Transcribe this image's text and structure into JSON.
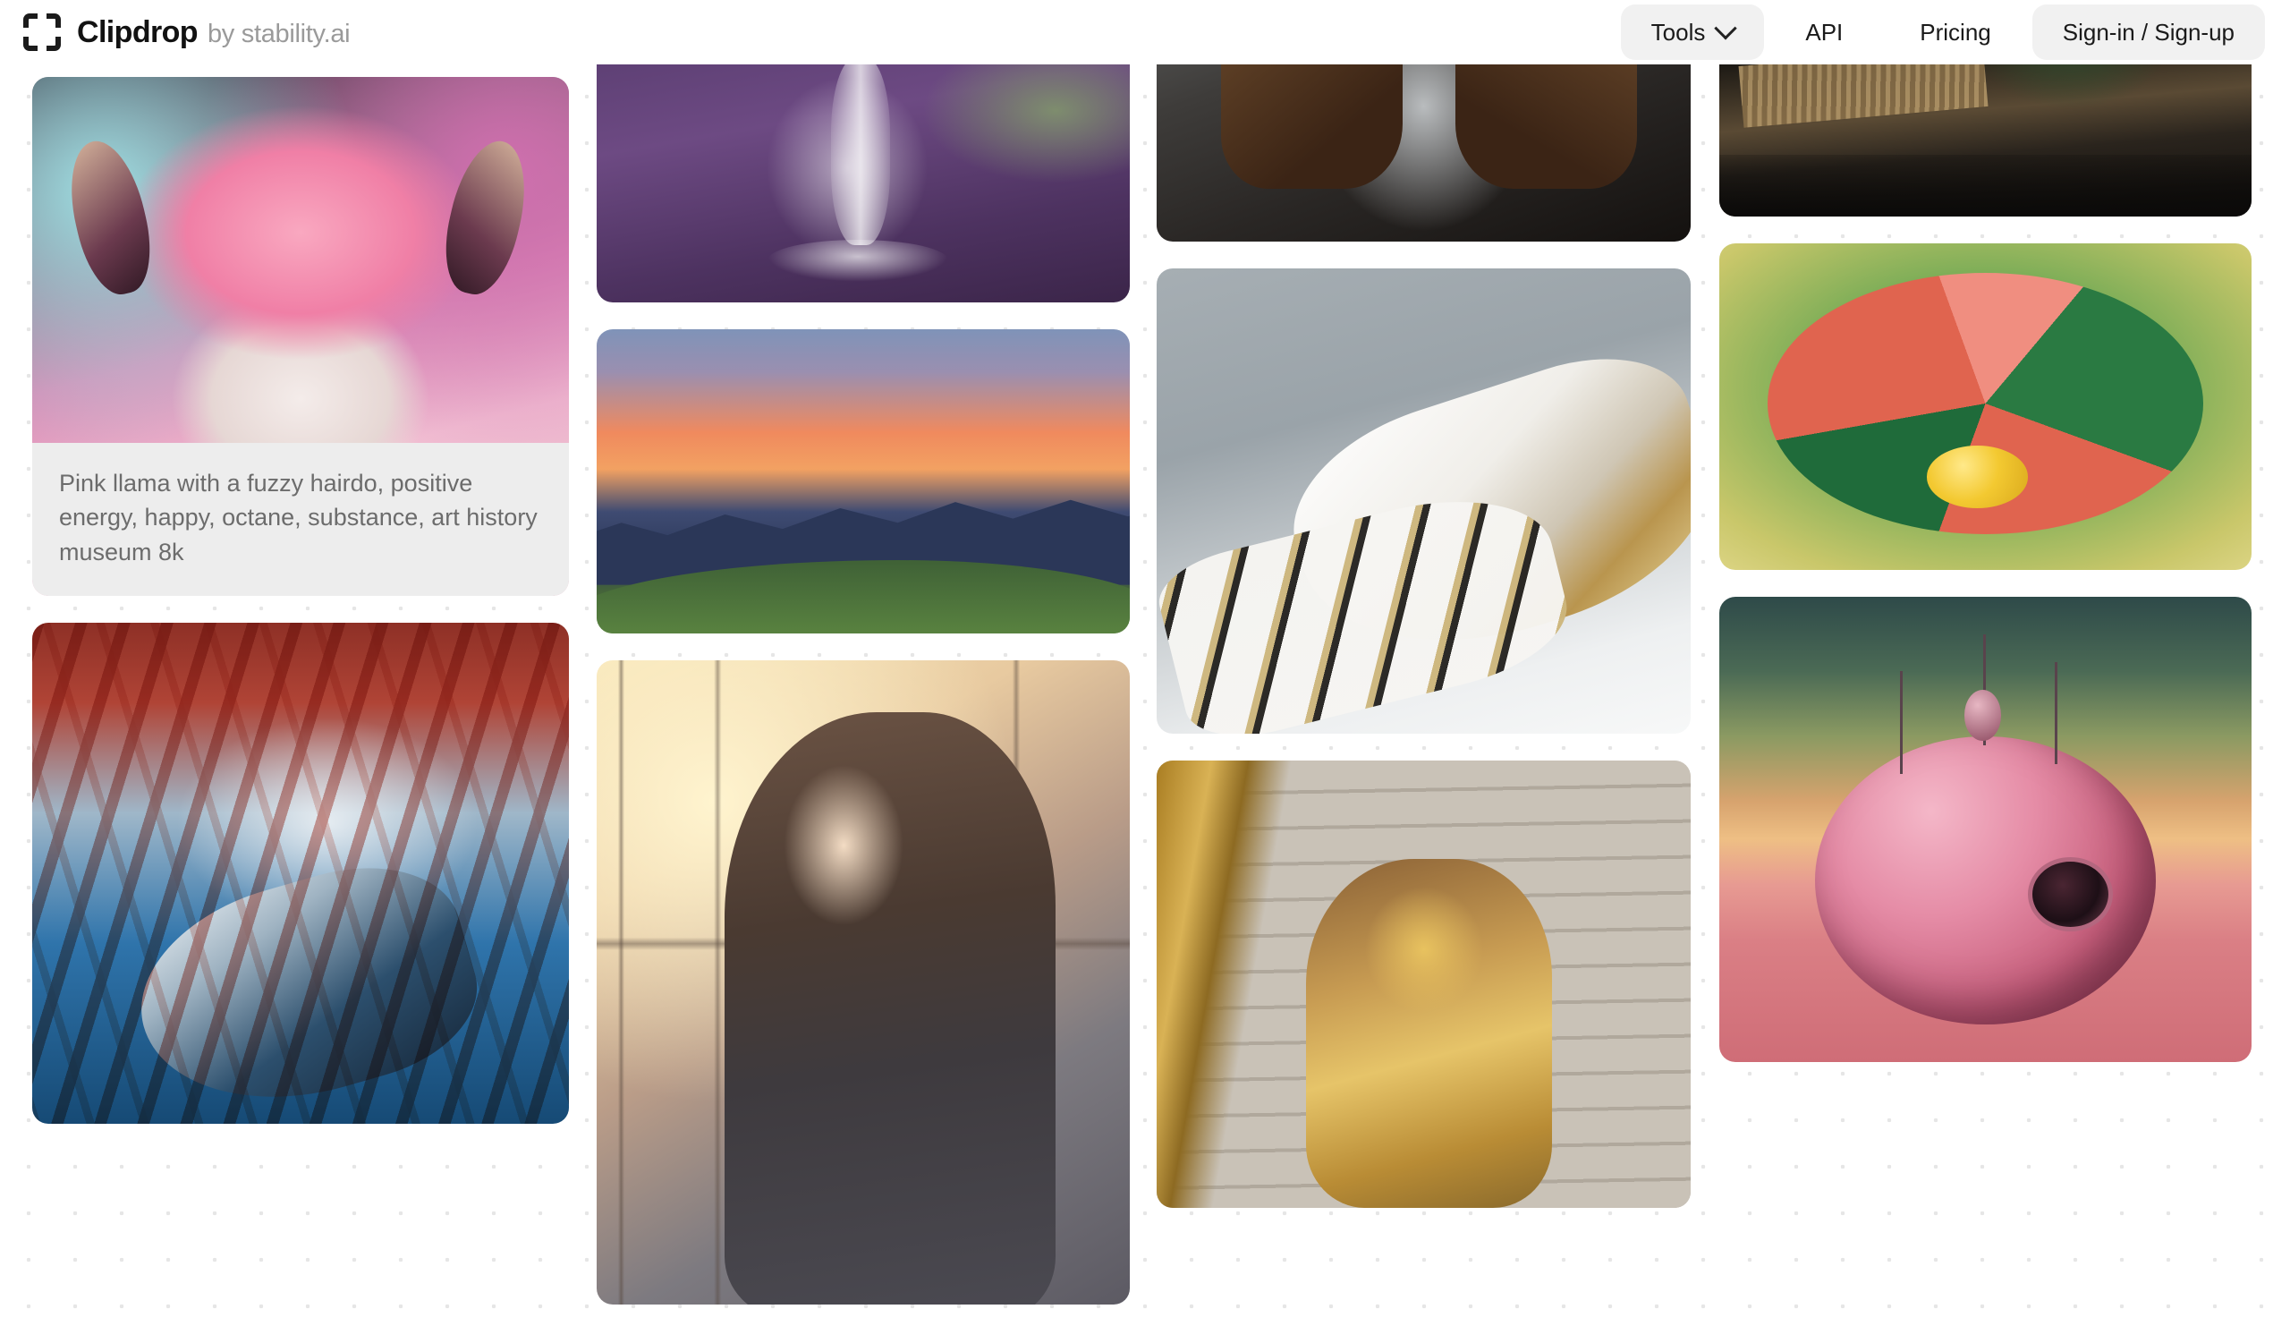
{
  "header": {
    "logo": {
      "icon": "clipdrop-brackets-icon",
      "name": "Clipdrop",
      "by": "by stability.ai"
    },
    "nav": {
      "tools": {
        "label": "Tools",
        "chevron_icon": "chevron-down-icon"
      },
      "api": {
        "label": "API"
      },
      "pricing": {
        "label": "Pricing"
      },
      "signin": {
        "label": "Sign-in / Sign-up"
      }
    }
  },
  "gallery": {
    "columns": [
      {
        "cards": [
          {
            "name": "pink-llama",
            "alt": "Pink llama with fuzzy pink hairdo on teal and magenta background",
            "caption": "Pink llama with a fuzzy hairdo, positive energy, happy, octane, substance, art history museum 8k"
          },
          {
            "name": "whale-with-red-fish",
            "alt": "Blue whale swimming beneath a dense swarm of red fish"
          }
        ]
      },
      {
        "cards": [
          {
            "name": "lavender-glass-still-life",
            "alt": "Crystal glass stem with lavender sprigs on a purple backdrop"
          },
          {
            "name": "mountain-sunset",
            "alt": "Orange sunset clouds over blue mountain ridges and green hills"
          },
          {
            "name": "anime-girl-at-window",
            "alt": "Anime girl with flowing hair looking out a sunlit window"
          }
        ]
      },
      {
        "cards": [
          {
            "name": "biker-leather-jacket",
            "alt": "Close-up of a biker in a brown leather jacket beside a motorcycle"
          },
          {
            "name": "robotic-hand",
            "alt": "White and gold robotic hand on a gray background"
          },
          {
            "name": "gold-painted-woman-on-stairs",
            "alt": "Woman with gold paint and gold jacket seated on marble stairs"
          }
        ]
      },
      {
        "cards": [
          {
            "name": "dark-deck-planter",
            "alt": "Dark wooden deck with a planter of succulents"
          },
          {
            "name": "watermelon-painting",
            "alt": "Stylised painting of a carved watermelon with a yellow sphere"
          },
          {
            "name": "pink-sphere-droid",
            "alt": "Pink spherical retro-futuristic droid in a desert landscape"
          }
        ]
      }
    ]
  },
  "colors": {
    "page_background": "#ffffff",
    "dot_grid": "#e6e6e6",
    "pill_background": "#f1f1f1",
    "brand_dark": "#121212",
    "brand_gray": "#9a9a9a",
    "caption_background": "#ededed",
    "caption_text": "#6c6c6c"
  }
}
